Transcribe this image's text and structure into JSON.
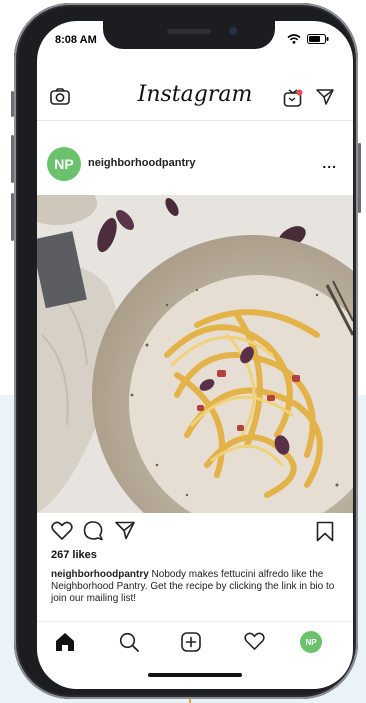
{
  "status_bar": {
    "time": "8:08 AM"
  },
  "header": {
    "logo_text": "Instagram",
    "left_icon": "camera-icon",
    "right_icons": [
      "igtv-icon",
      "direct-message-icon"
    ],
    "notification_dot_color": "#ed4956"
  },
  "post": {
    "avatar_initials": "NP",
    "avatar_color": "#6cc26c",
    "username": "neighborhoodpantry",
    "more_icon": "...",
    "likes": "267 likes",
    "caption_user": "neighborhoodpantry",
    "caption_text": " Nobody makes fettucini alfredo like the Neighborhood Pantry. Get the recipe by clicking the link in bio to join our mailing list!",
    "action_icons": [
      "heart-icon",
      "comment-icon",
      "share-icon",
      "bookmark-icon"
    ]
  },
  "tab_bar": {
    "items": [
      "home-icon",
      "search-icon",
      "add-post-icon",
      "activity-heart-icon",
      "profile-avatar"
    ],
    "profile_initials": "NP"
  },
  "colors": {
    "accent_connector": "#e8a317",
    "background_band": "#e9f3f8"
  }
}
